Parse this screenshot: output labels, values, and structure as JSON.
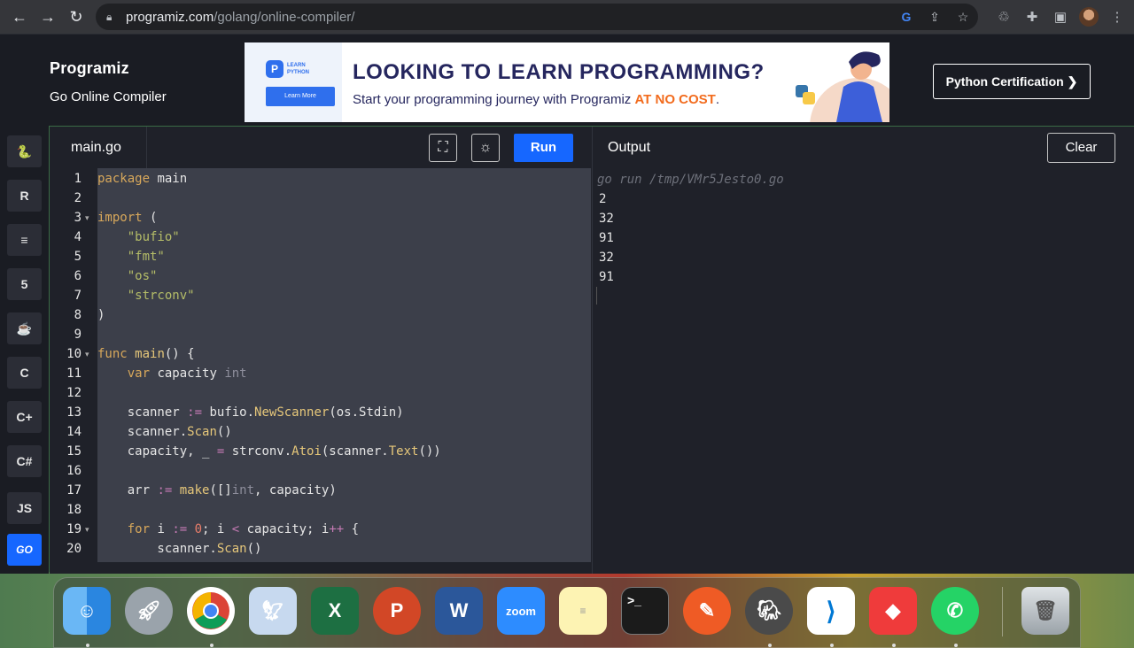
{
  "browser": {
    "url_domain": "programiz.com",
    "url_path": "/golang/online-compiler/"
  },
  "header": {
    "logo": "Programiz",
    "subtitle": "Go Online Compiler",
    "certification_button": "Python Certification ❯"
  },
  "banner": {
    "badge_text": "LEARN PYTHON",
    "learn_more": "Learn More",
    "title": "LOOKING TO LEARN PROGRAMMING?",
    "subtitle_prefix": "Start your programming journey with Programiz ",
    "subtitle_highlight": "AT NO COST",
    "subtitle_suffix": "."
  },
  "sidebar": {
    "languages": [
      {
        "name": "python",
        "label": "🐍"
      },
      {
        "name": "r",
        "label": "R"
      },
      {
        "name": "sql",
        "label": "≡"
      },
      {
        "name": "html",
        "label": "5"
      },
      {
        "name": "java",
        "label": "☕"
      },
      {
        "name": "c",
        "label": "C"
      },
      {
        "name": "cpp",
        "label": "C+"
      },
      {
        "name": "csharp",
        "label": "C#"
      },
      {
        "name": "js",
        "label": "JS"
      },
      {
        "name": "go",
        "label": "GO"
      }
    ]
  },
  "editor": {
    "file_name": "main.go",
    "run_label": "Run",
    "line_numbers": [
      "1",
      "2",
      "3",
      "4",
      "5",
      "6",
      "7",
      "8",
      "9",
      "10",
      "11",
      "12",
      "13",
      "14",
      "15",
      "16",
      "17",
      "18",
      "19",
      "20"
    ]
  },
  "output": {
    "title": "Output",
    "clear_label": "Clear",
    "command": "go run /tmp/VMr5Jesto0.go",
    "lines": [
      "2",
      "32",
      "91",
      "32",
      "91"
    ]
  }
}
